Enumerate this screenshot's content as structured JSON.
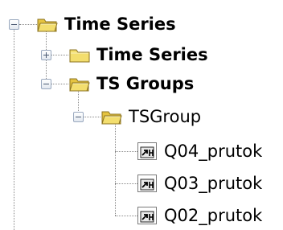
{
  "tree": {
    "root": {
      "label": "Time Series",
      "expanded": true
    },
    "child_time_series": {
      "label": "Time Series",
      "expanded": false
    },
    "child_ts_groups": {
      "label": "TS Groups",
      "expanded": true
    },
    "tsgroup": {
      "label": "TSGroup",
      "expanded": true
    },
    "leaves": [
      {
        "label": "Q04_prutok"
      },
      {
        "label": "Q03_prutok"
      },
      {
        "label": "Q02_prutok"
      }
    ]
  },
  "icons": {
    "expanded": "collapse-minus-icon",
    "collapsed": "expand-plus-icon",
    "open_folder": "open-folder-icon",
    "closed_folder": "folder-icon",
    "leaf": "time-series-shortcut-icon"
  },
  "colors": {
    "folder_fill": "#f3de6e",
    "folder_border": "#8b7322",
    "tree_line": "#8a8a8a"
  }
}
